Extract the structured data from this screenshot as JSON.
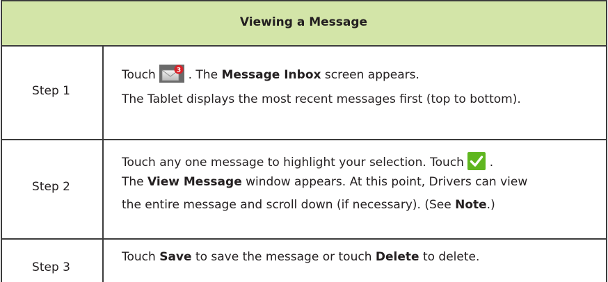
{
  "header": {
    "title": "Viewing a Message"
  },
  "icons": {
    "mail": "mail-badge-icon",
    "check": "check-icon",
    "badge_count": "3"
  },
  "steps": [
    {
      "label": "Step 1",
      "line1": {
        "pre": "Touch",
        "post_icon": ". The",
        "bold": "Message Inbox",
        "post": "screen appears."
      },
      "line2": "The Tablet displays the most recent messages first (top to bottom)."
    },
    {
      "label": "Step 2",
      "line1": {
        "text": "Touch any one message to highlight your selection. Touch",
        "post_icon": "."
      },
      "line2": {
        "pre": "The",
        "bold": "View Message",
        "post": "window appears. At this point, Drivers can view"
      },
      "line3": {
        "pre": "the entire message and scroll down (if necessary). (See",
        "bold": "Note",
        "post": ".)"
      }
    },
    {
      "label": "Step 3",
      "line1": {
        "pre": "Touch",
        "bold1": "Save",
        "mid": "to save the message or touch",
        "bold2": "Delete",
        "post": "to delete."
      }
    }
  ]
}
